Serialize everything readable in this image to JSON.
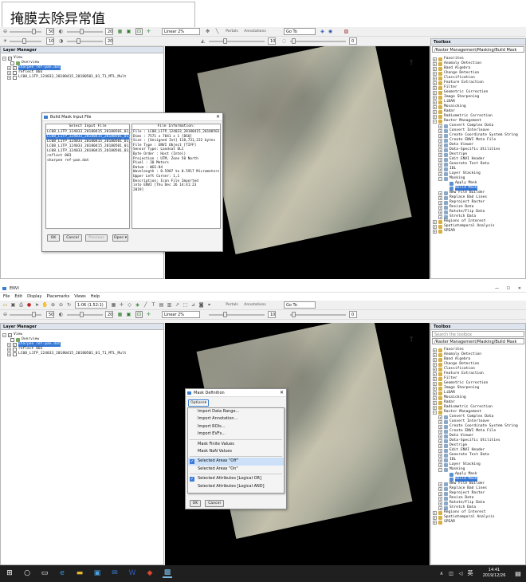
{
  "annotation_title": "掩膜去除异常值",
  "app": {
    "window_title": "ENVI",
    "menu": [
      "File",
      "Edit",
      "Display",
      "Placemarks",
      "Views",
      "Help"
    ],
    "toolbar": {
      "zoom_value": "50",
      "rotate_value": "20",
      "zoom_combo": "1:06 (1.52:1)",
      "stretch": "Linear 2%",
      "portals": "Portals",
      "annotations": "Annotations",
      "goto": "Go To",
      "bright_value": "10",
      "contrast_value": "20",
      "sharpen_value": "10",
      "transp_value": "0"
    }
  },
  "layer_manager": {
    "title": "Layer Manager",
    "items": [
      {
        "label": "View",
        "level": 0
      },
      {
        "label": "Overview",
        "level": 1
      },
      {
        "label": "sharpen ref-pan.dat",
        "level": 1,
        "selected": true
      },
      {
        "label": "reflect 003",
        "level": 1
      },
      {
        "label": "LC08_L1TP_124033_20180415_20180501_01_T1_MTL_Mult",
        "level": 1
      }
    ]
  },
  "toolbox": {
    "title": "Toolbox",
    "path": "/Raster Management/Masking/Build Mask",
    "search_placeholder": "Search the toolbox",
    "items": [
      {
        "label": "Favorites",
        "level": 0
      },
      {
        "label": "Anomaly Detection",
        "level": 0
      },
      {
        "label": "Band Algebra",
        "level": 0
      },
      {
        "label": "Change Detection",
        "level": 0
      },
      {
        "label": "Classification",
        "level": 0
      },
      {
        "label": "Feature Extraction",
        "level": 0
      },
      {
        "label": "Filter",
        "level": 0
      },
      {
        "label": "Geometric Correction",
        "level": 0
      },
      {
        "label": "Image Sharpening",
        "level": 0
      },
      {
        "label": "LiDAR",
        "level": 0
      },
      {
        "label": "Mosaicking",
        "level": 0
      },
      {
        "label": "Radar",
        "level": 0
      },
      {
        "label": "Radiometric Correction",
        "level": 0
      },
      {
        "label": "Raster Management",
        "level": 0
      },
      {
        "label": "Convert Complex Data",
        "level": 1
      },
      {
        "label": "Convert Interleave",
        "level": 1
      },
      {
        "label": "Create Coordinate System String",
        "level": 1
      },
      {
        "label": "Create ENVI Meta File",
        "level": 1
      },
      {
        "label": "Data Viewer",
        "level": 1
      },
      {
        "label": "Data-Specific Utilities",
        "level": 1
      },
      {
        "label": "Destripe",
        "level": 1
      },
      {
        "label": "Edit ENVI Header",
        "level": 1
      },
      {
        "label": "Generate Test Data",
        "level": 1
      },
      {
        "label": "IDL",
        "level": 1
      },
      {
        "label": "Layer Stacking",
        "level": 1
      },
      {
        "label": "Masking",
        "level": 1
      },
      {
        "label": "Apply Mask",
        "level": 2
      },
      {
        "label": "Build Mask",
        "level": 2,
        "selected": true
      },
      {
        "label": "New File Builder",
        "level": 1
      },
      {
        "label": "Replace Bad Lines",
        "level": 1
      },
      {
        "label": "Reproject Raster",
        "level": 1
      },
      {
        "label": "Resize Data",
        "level": 1
      },
      {
        "label": "Rotate/Flip Data",
        "level": 1
      },
      {
        "label": "Stretch Data",
        "level": 1
      },
      {
        "label": "Regions of Interest",
        "level": 0
      },
      {
        "label": "Spatiotemporal Analysis",
        "level": 0
      },
      {
        "label": "SPEAR",
        "level": 0
      }
    ]
  },
  "build_mask_dialog": {
    "title": "Build Mask Input File",
    "select_input_label": "Select Input File",
    "files": [
      "LC08_L1TP_124033_20180415_20180501_01_T1",
      "LC08_L1TP_124033_20180415_20180501_01_T1",
      "LC08_L1TP_124033_20180415_20180501_01_T1",
      "LC08_L1TP_124033_20180415_20180501_01_T1",
      "LC08_L1TP_124033_20180415_20180501_01_T1",
      "reflect 003",
      "sharpen ref-pan.dat"
    ],
    "file_info_label": "File Information:",
    "info_lines": [
      "File : LC08_L1TP_124033_20180415_20180501",
      "Dims : 7571 x 7841 x 1 [BSQ]",
      "Size : [Unsigned Int] 118,731,222 bytes",
      "File Type : ENVI Object [TIFF]",
      "Sensor Type: Landsat OLI",
      "Byte Order : Host (Intel)",
      "Projection : UTM, Zone 50 North",
      "Pixel : 30 Meters",
      "Datum : WGS-84",
      "Wavelength : 0.5907 to 0.5917 Micrometers",
      "Upper Left Corner: 1,1",
      "Description: Icon File Imported",
      "into ENVI [Thu Dec 26 14:41:23",
      "2019]"
    ],
    "buttons": {
      "ok": "OK",
      "cancel": "Cancel",
      "previous": "Previous",
      "open": "Open"
    }
  },
  "mask_definition": {
    "title": "Mask Definition",
    "options_label": "Options",
    "menu_items": [
      {
        "label": "Import Data Range...",
        "checked": false,
        "group": 1
      },
      {
        "label": "Import Annotation...",
        "checked": false,
        "group": 1
      },
      {
        "label": "Import ROIs...",
        "checked": false,
        "group": 1
      },
      {
        "label": "Import EVFs...",
        "checked": false,
        "group": 1
      },
      {
        "label": "Mask Finite Values",
        "checked": false,
        "group": 2
      },
      {
        "label": "Mask NaN Values",
        "checked": false,
        "group": 2
      },
      {
        "label": "Selected Areas \"Off\"",
        "checked": true,
        "group": 3,
        "highlight": true
      },
      {
        "label": "Selected Areas \"On\"",
        "checked": false,
        "group": 3
      },
      {
        "label": "Selected Attributes [Logical OR]",
        "checked": true,
        "group": 4
      },
      {
        "label": "Selected Attributes [Logical AND]",
        "checked": false,
        "group": 4
      }
    ],
    "buttons": {
      "ok": "OK",
      "cancel": "Cancel"
    }
  },
  "taskbar": {
    "time": "14:41",
    "date": "2019/12/26",
    "lang": "英"
  },
  "colors": {
    "selection": "#3477d4",
    "panel_header": "#dde4ee",
    "taskbar": "#1f1f1f"
  }
}
